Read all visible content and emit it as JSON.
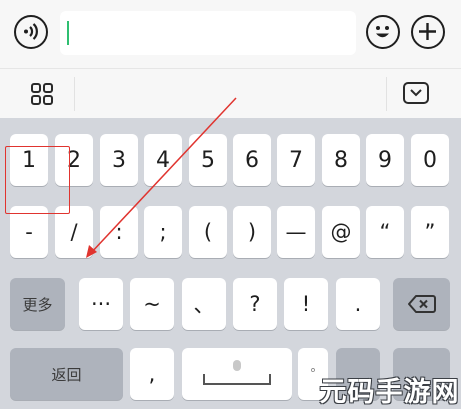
{
  "input_bar": {
    "voice_icon": "voice-icon",
    "input_value": "",
    "emoji_icon": "emoji-icon",
    "plus_icon": "plus-icon"
  },
  "toolbar": {
    "grid_icon": "grid-icon",
    "collapse_icon": "chevron-down-icon"
  },
  "keyboard": {
    "row1": [
      "1",
      "2",
      "3",
      "4",
      "5",
      "6",
      "7",
      "8",
      "9",
      "0"
    ],
    "row2": [
      "-",
      "/",
      ":",
      ";",
      "(",
      ")",
      "—",
      "@",
      "“",
      "”"
    ],
    "row3_more": "更多",
    "row3": [
      "···",
      "~",
      "、",
      "?",
      "!",
      "."
    ],
    "backspace_icon": "backspace-icon",
    "row4_back": "返回",
    "row4": [
      ",",
      "",
      "°"
    ]
  },
  "annotation": {
    "highlight_color": "#e0342f"
  },
  "watermark": "元码手游网"
}
